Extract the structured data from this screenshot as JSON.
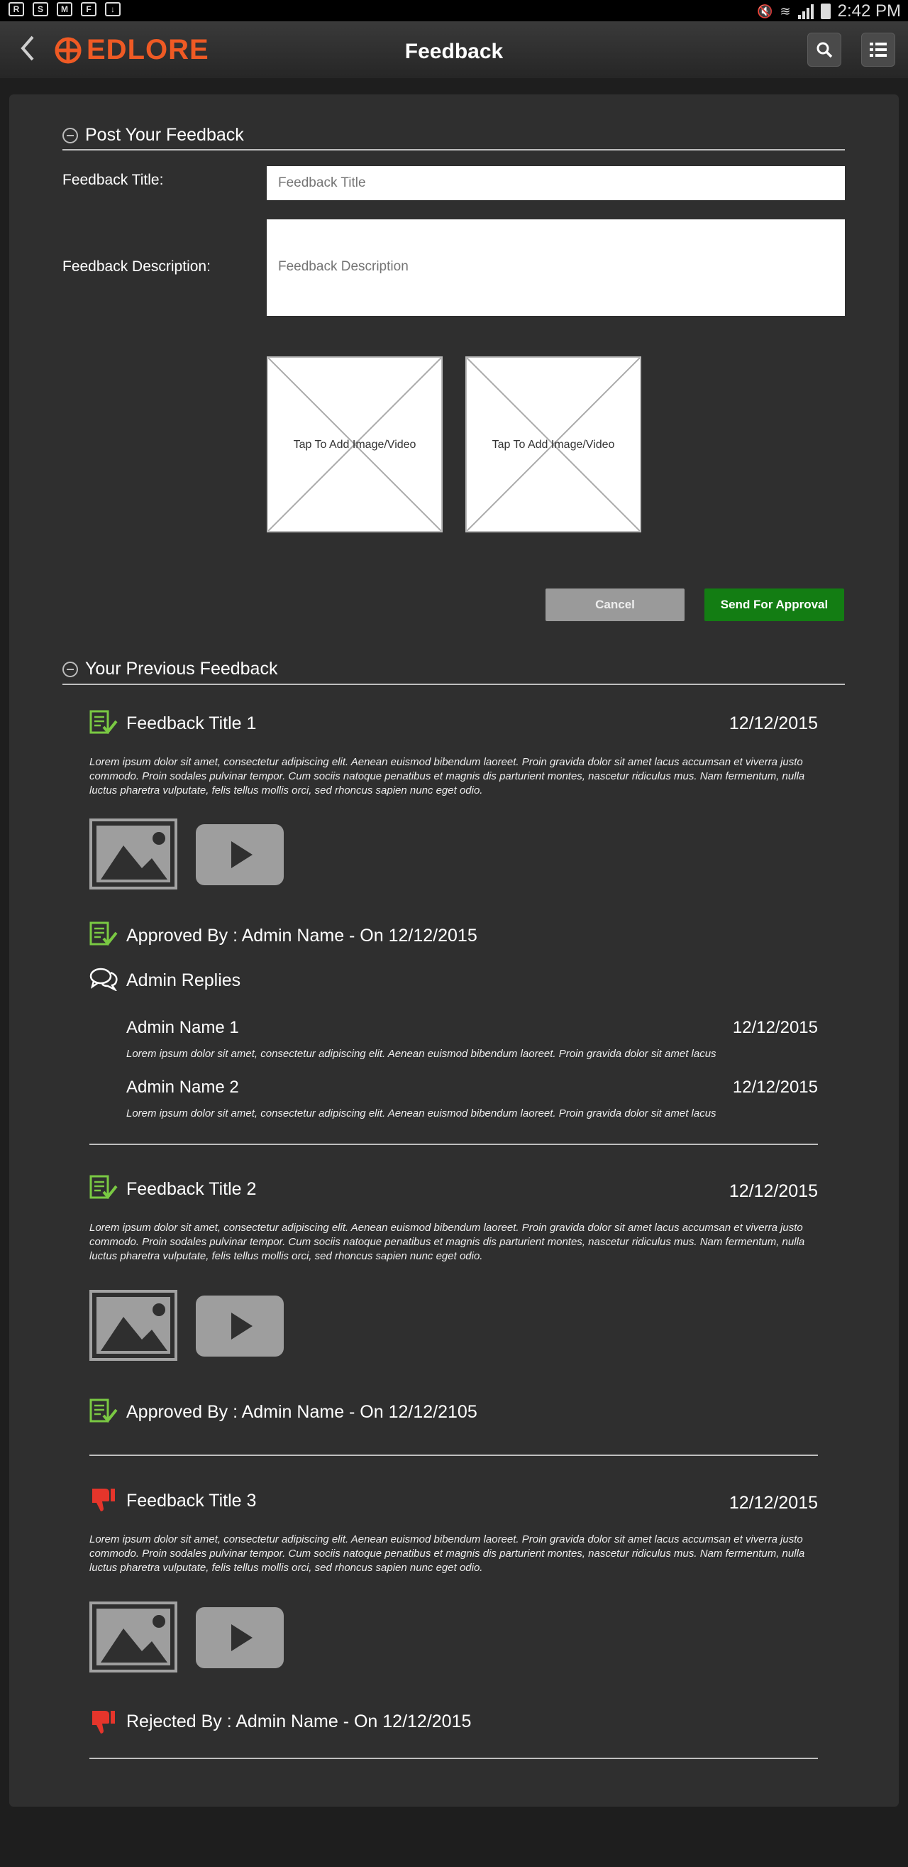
{
  "status_bar": {
    "time": "2:42 PM"
  },
  "app_bar": {
    "brand": "EDLORE",
    "title": "Feedback"
  },
  "post_section": {
    "heading": "Post Your Feedback",
    "title_label": "Feedback Title:",
    "title_placeholder": "Feedback Title",
    "description_label": "Feedback Description:",
    "description_placeholder": "Feedback Description",
    "media_slots": [
      "Tap To Add Image/Video",
      "Tap To Add Image/Video"
    ],
    "cancel_label": "Cancel",
    "send_label": "Send For Approval"
  },
  "previous_section": {
    "heading": "Your Previous Feedback",
    "items": [
      {
        "title": "Feedback Title 1",
        "date": "12/12/2015",
        "body": "Lorem ipsum dolor sit amet, consectetur adipiscing elit. Aenean euismod bibendum laoreet. Proin gravida dolor sit amet lacus accumsan et viverra justo commodo. Proin sodales pulvinar tempor. Cum sociis natoque penatibus et magnis dis parturient montes, nascetur ridiculus mus. Nam fermentum, nulla luctus pharetra vulputate, felis tellus mollis orci, sed rhoncus sapien nunc eget odio.",
        "status": "Approved By : Admin Name - On 12/12/2015",
        "replies_label": "Admin Replies",
        "replies": [
          {
            "name": "Admin Name 1",
            "date": "12/12/2015",
            "text": "Lorem ipsum dolor sit amet, consectetur adipiscing elit. Aenean euismod bibendum laoreet. Proin gravida dolor sit amet lacus"
          },
          {
            "name": "Admin Name 2",
            "date": "12/12/2015",
            "text": "Lorem ipsum dolor sit amet, consectetur adipiscing elit. Aenean euismod bibendum laoreet. Proin gravida dolor sit amet lacus"
          }
        ]
      },
      {
        "title": "Feedback Title 2",
        "date": "12/12/2015",
        "body": "Lorem ipsum dolor sit amet, consectetur adipiscing elit. Aenean euismod bibendum laoreet. Proin gravida dolor sit amet lacus accumsan et viverra justo commodo. Proin sodales pulvinar tempor. Cum sociis natoque penatibus et magnis dis parturient montes, nascetur ridiculus mus. Nam fermentum, nulla luctus pharetra vulputate, felis tellus mollis orci, sed rhoncus sapien nunc eget odio.",
        "status": "Approved By : Admin Name - On 12/12/2105"
      },
      {
        "title": "Feedback Title 3",
        "date": "12/12/2015",
        "body": "Lorem ipsum dolor sit amet, consectetur adipiscing elit. Aenean euismod bibendum laoreet. Proin gravida dolor sit amet lacus accumsan et viverra justo commodo. Proin sodales pulvinar tempor. Cum sociis natoque penatibus et magnis dis parturient montes, nascetur ridiculus mus. Nam fermentum, nulla luctus pharetra vulputate, felis tellus mollis orci, sed rhoncus sapien nunc eget odio.",
        "status": "Rejected By : Admin Name  - On 12/12/2015"
      }
    ]
  },
  "icons": {
    "approved": "approved-doc-icon",
    "rejected": "thumbs-down-icon",
    "replies": "chat-bubbles-icon",
    "image": "image-icon",
    "video": "play-icon"
  },
  "colors": {
    "brand": "#ef5a24",
    "approve_green": "#7ac943",
    "reject_red": "#e5352b",
    "send_button": "#137d13",
    "cancel_button": "#9a9a9a"
  }
}
